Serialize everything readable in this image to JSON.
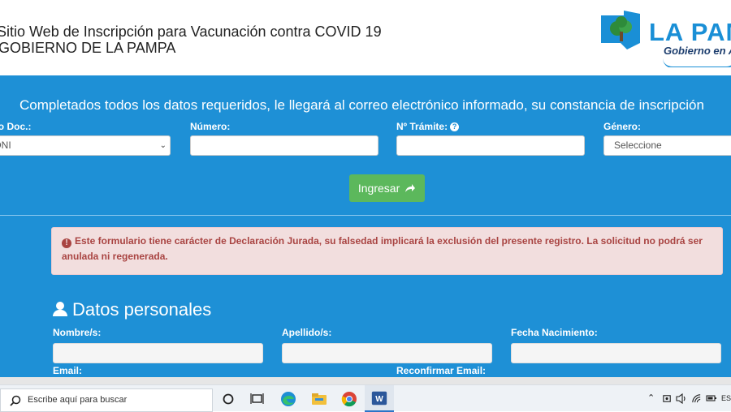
{
  "header": {
    "title": "Sitio Web de Inscripción para Vacunación contra COVID 19",
    "subtitle": "GOBIERNO DE LA PAMPA",
    "logo_text": "LA PAMPA",
    "logo_sub": "Gobierno en Acción"
  },
  "form": {
    "notice": "Completados todos los datos requeridos, le llegará al correo electrónico informado, su constancia de inscripción",
    "tipo_doc_label": "Tipo Doc.:",
    "tipo_doc_value": "DNI",
    "numero_label": "Número:",
    "numero_value": "",
    "tramite_label": "Nº Trámite:",
    "tramite_value": "",
    "genero_label": "Género:",
    "genero_value": "Seleccione",
    "ingresar_label": "Ingresar"
  },
  "alert": {
    "text": "Este formulario tiene carácter de Declaración Jurada, su falsedad implicará la exclusión del presente registro. La solicitud no podrá ser anulada ni regenerada."
  },
  "personal": {
    "title": "Datos personales",
    "nombre_label": "Nombre/s:",
    "apellido_label": "Apellido/s:",
    "fecha_label": "Fecha Nacimiento:",
    "email_label": "Email:",
    "reconfirmar_label": "Reconfirmar Email:"
  },
  "taskbar": {
    "search_placeholder": "Escribe aquí para buscar",
    "tray_lang": "ESP"
  },
  "colors": {
    "primary": "#1e90d6",
    "success": "#5cb85c",
    "alert_bg": "#f2dede",
    "alert_text": "#a94442"
  }
}
